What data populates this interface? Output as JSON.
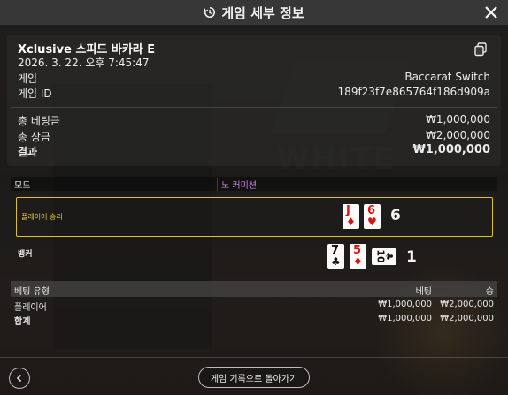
{
  "header": {
    "title": "게임 세부 정보",
    "icon": "history-icon",
    "close_icon": "close-icon"
  },
  "summary": {
    "game_name": "Xclusive 스피드 바카라 E",
    "datetime": "2026. 3. 22. 오후 7:45:47",
    "game_label": "게임",
    "game_value": "Baccarat Switch",
    "game_id_label": "게임 ID",
    "game_id_value": "189f23f7e865764f186d909a",
    "copy_icon": "copy-icon"
  },
  "totals": {
    "total_bet_label": "총 베팅금",
    "total_bet_value": "₩1,000,000",
    "total_win_label": "총 상금",
    "total_win_value": "₩2,000,000",
    "result_label": "결과",
    "result_value": "₩1,000,000"
  },
  "mode": {
    "label": "모드",
    "value": "노 커미션"
  },
  "hands": {
    "player": {
      "label": "플레이어 승리",
      "cards": [
        {
          "rank": "J",
          "suit": "♦",
          "color": "red"
        },
        {
          "rank": "6",
          "suit": "♥",
          "color": "red"
        }
      ],
      "score": "6"
    },
    "banker": {
      "label": "뱅커",
      "cards": [
        {
          "rank": "7",
          "suit": "♣",
          "color": "black"
        },
        {
          "rank": "5",
          "suit": "♦",
          "color": "red"
        },
        {
          "rank": "10",
          "suit": "♣",
          "color": "black"
        }
      ],
      "score": "1"
    }
  },
  "bet_table": {
    "columns": [
      "베팅 유형",
      "베팅",
      "승"
    ],
    "rows": [
      {
        "type": "플레이어",
        "bet": "₩1,000,000",
        "win": "₩2,000,000"
      }
    ],
    "total": {
      "type": "합계",
      "bet": "₩1,000,000",
      "win": "₩2,000,000"
    }
  },
  "footer": {
    "back_icon": "chevron-left-icon",
    "back_label": "게임 기록으로 돌아가기"
  },
  "colors": {
    "accent_highlight": "#e0c02a",
    "mode_value": "#c58cf0",
    "card_red": "#dd1111"
  }
}
